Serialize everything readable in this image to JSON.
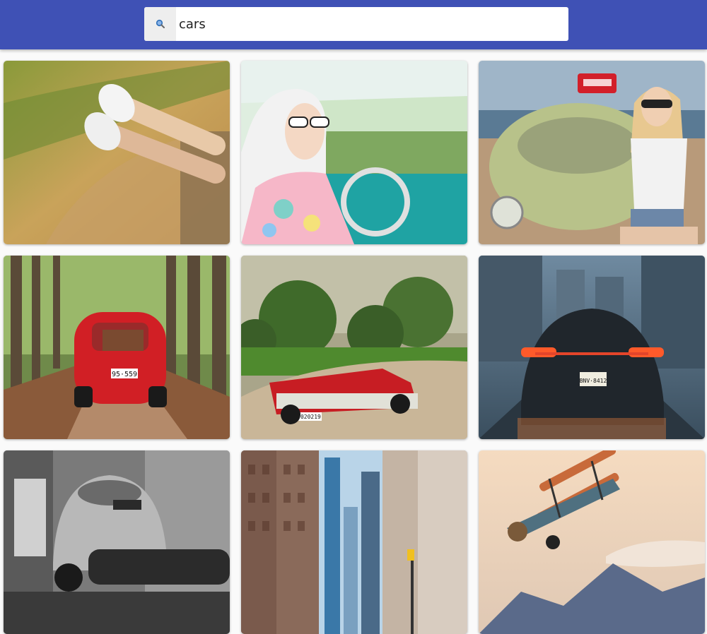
{
  "search": {
    "value": "cars",
    "icon": "search-icon"
  },
  "colors": {
    "header": "#3f51b5",
    "search_bg": "#ffffff",
    "icon_box": "#eeeeee"
  },
  "results": [
    {
      "subject": "sneakers-legs-out-car-window"
    },
    {
      "subject": "woman-headscarf-driving-vintage-car"
    },
    {
      "subject": "woman-sitting-on-beetle-beach"
    },
    {
      "subject": "red-fiat-500-forest-road",
      "plate_text": "95·559"
    },
    {
      "subject": "red-vintage-convertible-dirt-road",
      "plate_text": "F020219"
    },
    {
      "subject": "black-porsche-rear-city-street",
      "plate_text": "BNV·8412"
    },
    {
      "subject": "mechanic-under-beetle-garage-bw"
    },
    {
      "subject": "city-street-skyscrapers"
    },
    {
      "subject": "biplane-sunset-sky"
    }
  ]
}
